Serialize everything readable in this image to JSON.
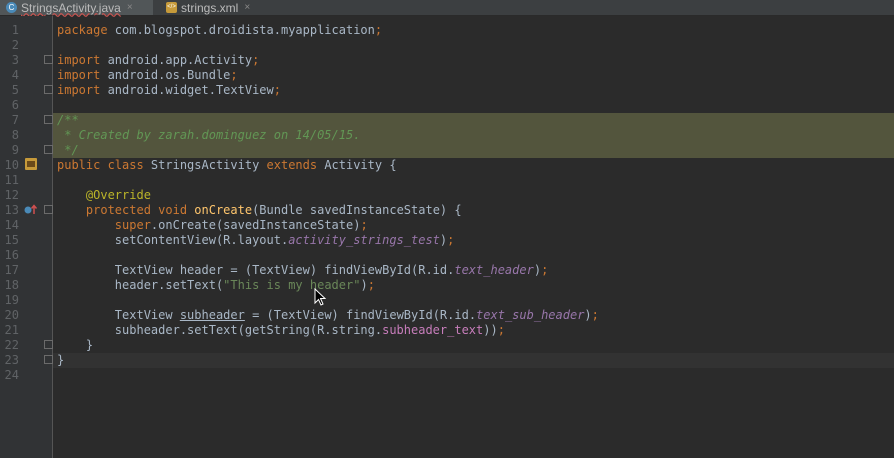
{
  "tabs": [
    {
      "icon": "C",
      "label": "StringsActivity.java",
      "close": "×",
      "active": true
    },
    {
      "icon": "</>",
      "label": "strings.xml",
      "close": "×",
      "active": false
    }
  ],
  "lines": [
    {
      "n": "1",
      "tokens": [
        [
          "kw",
          "package "
        ],
        [
          "",
          "com.blogspot.droidista.myapplication"
        ],
        [
          "kw",
          ";"
        ]
      ]
    },
    {
      "n": "2",
      "tokens": []
    },
    {
      "n": "3",
      "tokens": [
        [
          "kw",
          "import "
        ],
        [
          "",
          "android.app.Activity"
        ],
        [
          "kw",
          ";"
        ]
      ]
    },
    {
      "n": "4",
      "tokens": [
        [
          "kw",
          "import "
        ],
        [
          "",
          "android.os.Bundle"
        ],
        [
          "kw",
          ";"
        ]
      ]
    },
    {
      "n": "5",
      "tokens": [
        [
          "kw",
          "import "
        ],
        [
          "",
          "android.widget.TextView"
        ],
        [
          "kw",
          ";"
        ]
      ]
    },
    {
      "n": "6",
      "tokens": []
    },
    {
      "n": "7",
      "tokens": [
        [
          "doc",
          "/**"
        ]
      ]
    },
    {
      "n": "8",
      "tokens": [
        [
          "doc",
          " * Created by zarah.dominguez on 14/05/15."
        ]
      ]
    },
    {
      "n": "9",
      "tokens": [
        [
          "doc",
          " */"
        ]
      ]
    },
    {
      "n": "10",
      "tokens": [
        [
          "kw",
          "public class "
        ],
        [
          "",
          "StringsActivity "
        ],
        [
          "kw",
          "extends "
        ],
        [
          "",
          "Activity {"
        ]
      ]
    },
    {
      "n": "11",
      "tokens": []
    },
    {
      "n": "12",
      "tokens": [
        [
          "",
          "    "
        ],
        [
          "ann",
          "@Override"
        ]
      ]
    },
    {
      "n": "13",
      "tokens": [
        [
          "",
          "    "
        ],
        [
          "kw",
          "protected void "
        ],
        [
          "fn",
          "onCreate"
        ],
        [
          "",
          "(Bundle savedInstanceState) {"
        ]
      ]
    },
    {
      "n": "14",
      "tokens": [
        [
          "",
          "        "
        ],
        [
          "kw",
          "super"
        ],
        [
          "",
          ".onCreate(savedInstanceState)"
        ],
        [
          "kw",
          ";"
        ]
      ]
    },
    {
      "n": "15",
      "tokens": [
        [
          "",
          "        setContentView(R.layout."
        ],
        [
          "fld",
          "activity_strings_test"
        ],
        [
          "",
          ")"
        ],
        [
          "kw",
          ";"
        ]
      ]
    },
    {
      "n": "16",
      "tokens": []
    },
    {
      "n": "17",
      "tokens": [
        [
          "",
          "        TextView header = (TextView) findViewById(R.id."
        ],
        [
          "fld",
          "text_header"
        ],
        [
          "",
          ")"
        ],
        [
          "kw",
          ";"
        ]
      ]
    },
    {
      "n": "18",
      "tokens": [
        [
          "",
          "        header.setText("
        ],
        [
          "str",
          "\"This is my header\""
        ],
        [
          "",
          ")"
        ],
        [
          "kw",
          ";"
        ]
      ]
    },
    {
      "n": "19",
      "tokens": []
    },
    {
      "n": "20",
      "tokens": [
        [
          "",
          "        TextView "
        ],
        [
          "ul",
          "subheader"
        ],
        [
          "",
          " = (TextView) findViewById(R.id."
        ],
        [
          "fld",
          "text_sub_header"
        ],
        [
          "",
          ")"
        ],
        [
          "kw",
          ";"
        ]
      ]
    },
    {
      "n": "21",
      "tokens": [
        [
          "",
          "        subheader.setText(getString(R.string."
        ],
        [
          "res",
          "subheader_text"
        ],
        [
          "",
          "))"
        ],
        [
          "kw",
          ";"
        ]
      ]
    },
    {
      "n": "22",
      "tokens": [
        [
          "",
          "    }"
        ]
      ]
    },
    {
      "n": "23",
      "tokens": [
        [
          "",
          "}"
        ]
      ]
    },
    {
      "n": "24",
      "tokens": []
    }
  ]
}
